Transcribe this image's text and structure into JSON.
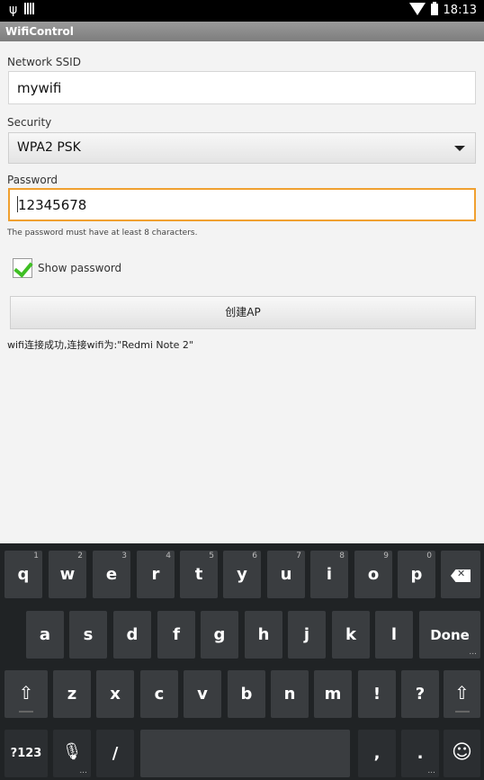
{
  "status_bar": {
    "time": "18:13",
    "usb_icon": "usb-icon",
    "wifi_icon": "wifi-icon",
    "battery_icon": "battery-icon"
  },
  "app": {
    "title": "WifiControl"
  },
  "form": {
    "ssid_label": "Network SSID",
    "ssid_value": "mywifi",
    "security_label": "Security",
    "security_value": "WPA2 PSK",
    "password_label": "Password",
    "password_value": "12345678",
    "password_hint": "The password must have at least 8 characters.",
    "show_password_label": "Show password",
    "show_password_checked": true,
    "create_ap_button": "创建AP",
    "status_message": "wifi连接成功,连接wifi为:\"Redmi Note 2\""
  },
  "keyboard": {
    "row1": [
      {
        "key": "q",
        "num": "1"
      },
      {
        "key": "w",
        "num": "2"
      },
      {
        "key": "e",
        "num": "3"
      },
      {
        "key": "r",
        "num": "4"
      },
      {
        "key": "t",
        "num": "5"
      },
      {
        "key": "y",
        "num": "6"
      },
      {
        "key": "u",
        "num": "7"
      },
      {
        "key": "i",
        "num": "8"
      },
      {
        "key": "o",
        "num": "9"
      },
      {
        "key": "p",
        "num": "0"
      }
    ],
    "row2": [
      "a",
      "s",
      "d",
      "f",
      "g",
      "h",
      "j",
      "k",
      "l"
    ],
    "done": "Done",
    "row3": [
      "z",
      "x",
      "c",
      "v",
      "b",
      "n",
      "m",
      "!",
      "?"
    ],
    "symbols": "?123",
    "slash": "/",
    "comma": ",",
    "period": ".",
    "icons": {
      "backspace": "backspace-icon",
      "shift": "shift-icon",
      "mic": "microphone-icon",
      "emoji": "emoji-icon"
    }
  }
}
